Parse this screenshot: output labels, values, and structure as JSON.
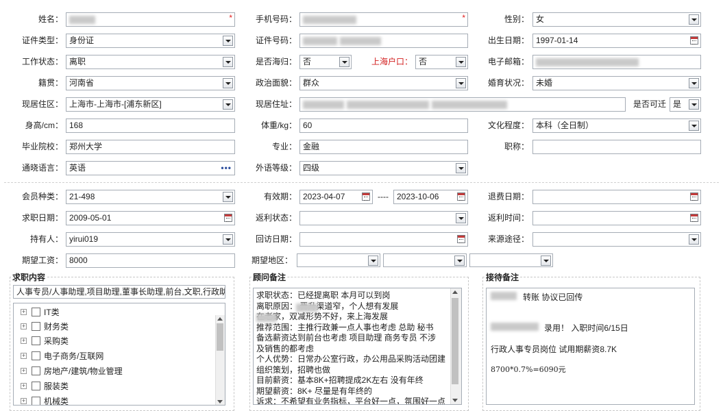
{
  "profile": {
    "name_label": "姓名：",
    "phone_label": "手机号码：",
    "gender_label": "性别：",
    "gender_value": "女",
    "id_type_label": "证件类型：",
    "id_type_value": "身份证",
    "id_no_label": "证件号码：",
    "birth_label": "出生日期：",
    "birth_value": "1997-01-14",
    "work_status_label": "工作状态：",
    "work_status_value": "离职",
    "returnee_label": "是否海归：",
    "returnee_value": "否",
    "sh_hukou_label": "上海户口：",
    "sh_hukou_value": "否",
    "email_label": "电子邮箱：",
    "native_label": "籍贯：",
    "native_value": "河南省",
    "political_label": "政治面貌：",
    "political_value": "群众",
    "marital_label": "婚育状况：",
    "marital_value": "未婚",
    "residence_area_label": "现居住区：",
    "residence_area_value": "上海市-上海市-[浦东新区]",
    "address_label": "现居住址：",
    "relocate_label": "是否可迁",
    "relocate_value": "是",
    "height_label": "身高/cm：",
    "height_value": "168",
    "weight_label": "体重/kg：",
    "weight_value": "60",
    "education_label": "文化程度：",
    "education_value": "本科（全日制）",
    "school_label": "毕业院校：",
    "school_value": "郑州大学",
    "major_label": "专业：",
    "major_value": "金融",
    "title_label": "职称：",
    "language_label": "通晓语言：",
    "language_value": "英语",
    "foreign_level_label": "外语等级：",
    "foreign_level_value": "四级"
  },
  "membership": {
    "type_label": "会员种类：",
    "type_value": "21-498",
    "valid_label": "有效期：",
    "valid_from": "2023-04-07",
    "valid_sep": "----",
    "valid_to": "2023-10-06",
    "refund_date_label": "退费日期：",
    "job_date_label": "求职日期：",
    "job_date_value": "2009-05-01",
    "rebate_status_label": "返利状态：",
    "rebate_time_label": "返利时间：",
    "holder_label": "持有人：",
    "holder_value": "yirui019",
    "visit_date_label": "回访日期：",
    "source_label": "来源途径：",
    "salary_label": "期望工资：",
    "salary_value": "8000",
    "region_label": "期望地区："
  },
  "job_content": {
    "legend": "求职内容",
    "summary": "人事专员/人事助理,项目助理,董事长助理,前台,文职,行政助",
    "categories": [
      "IT类",
      "财务类",
      "采购类",
      "电子商务/互联网",
      "房地产/建筑/物业管理",
      "服装类",
      "机械类"
    ]
  },
  "advisor_notes": {
    "legend": "顾问备注",
    "lines": [
      "求职状态：已经提离职    本月可以到岗",
      "离职原因：       晋升渠道窄，个人想有发展",
      "        在老家，双减形势不好，来上海发展",
      "推荐范围：主推行政兼一点人事也考虑  总助 秘书",
      "备选薪资达到前台也考虑 项目助理 商务专员 不涉",
      "及销售的都考虑",
      "个人优势：日常办公室行政，办公用品采购活动团建",
      "组织策划，招聘也做",
      "目前薪资：基本8K+招聘提成2K左右   没有年终",
      "期望薪资：8K+ 尽量是有年终的",
      "诉求：不希望有业务指标，平台好一点，氛围好一点"
    ]
  },
  "reception_notes": {
    "legend": "接待备注",
    "line1": "转账  协议已回传",
    "line2": "录用！  入职时间6/15日",
    "line3": "行政人事专员岗位  试用期薪资8.7K",
    "line4": "8700*0.7%=6090元"
  }
}
